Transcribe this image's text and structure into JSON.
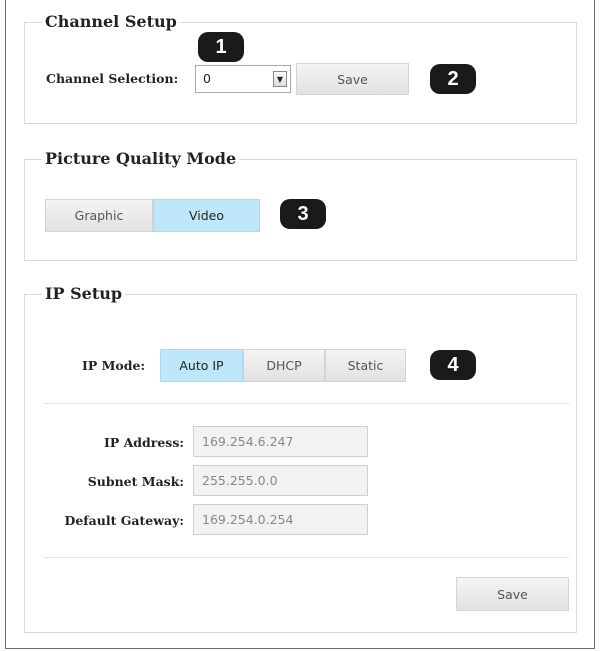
{
  "channel_setup": {
    "title": "Channel Setup",
    "selection_label": "Channel Selection:",
    "selection_value": "0",
    "save_label": "Save"
  },
  "picture_quality": {
    "title": "Picture Quality Mode",
    "options": [
      {
        "label": "Graphic",
        "selected": false
      },
      {
        "label": "Video",
        "selected": true
      }
    ]
  },
  "ip_setup": {
    "title": "IP Setup",
    "mode_label": "IP Mode:",
    "modes": [
      {
        "label": "Auto IP",
        "selected": true
      },
      {
        "label": "DHCP",
        "selected": false
      },
      {
        "label": "Static",
        "selected": false
      }
    ],
    "fields": [
      {
        "label": "IP Address:",
        "value": "169.254.6.247"
      },
      {
        "label": "Subnet Mask:",
        "value": "255.255.0.0"
      },
      {
        "label": "Default Gateway:",
        "value": "169.254.0.254"
      }
    ],
    "save_label": "Save"
  },
  "callouts": [
    "1",
    "2",
    "3",
    "4"
  ],
  "colors": {
    "selected_segment": "#bfe7fa",
    "callout_badge": "#1a1a1a",
    "panel_border": "#d9d9d9"
  }
}
